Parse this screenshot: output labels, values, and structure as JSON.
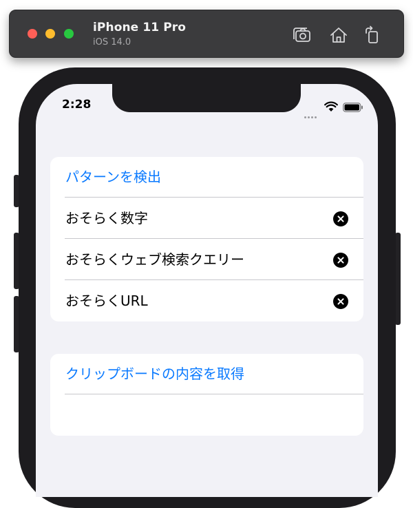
{
  "simulator": {
    "device_name": "iPhone 11 Pro",
    "os_version": "iOS 14.0",
    "toolbar_icons": [
      "screenshot-icon",
      "home-icon",
      "rotate-icon"
    ]
  },
  "status_bar": {
    "time": "2:28"
  },
  "section_patterns": {
    "action": "パターンを検出",
    "items": [
      {
        "label": "おそらく数字",
        "icon": "clear-icon"
      },
      {
        "label": "おそらくウェブ検索クエリー",
        "icon": "clear-icon"
      },
      {
        "label": "おそらくURL",
        "icon": "clear-icon"
      }
    ]
  },
  "section_clipboard": {
    "action": "クリップボードの内容を取得",
    "content": ""
  },
  "colors": {
    "accent": "#0a7aff",
    "background": "#f2f2f7",
    "card": "#ffffff",
    "separator": "#c7c7cc"
  }
}
